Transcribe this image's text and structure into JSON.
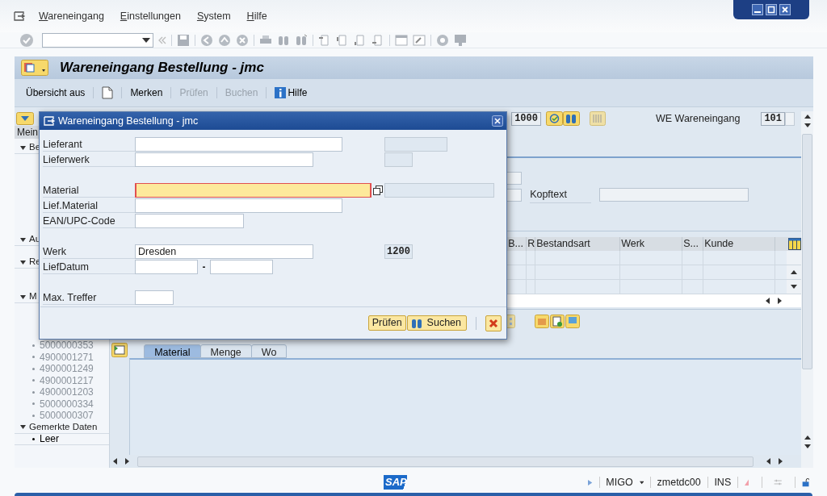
{
  "menu_bar": {
    "items": [
      "Wareneingang",
      "Einstellungen",
      "System",
      "Hilfe"
    ]
  },
  "title": "Wareneingang Bestellung - jmc",
  "app_toolbar": [
    {
      "kind": "text",
      "label": "Übersicht aus",
      "disabled": false
    },
    {
      "kind": "doc",
      "disabled": false
    },
    {
      "kind": "text",
      "label": "Merken",
      "disabled": false
    },
    {
      "kind": "text",
      "label": "Prüfen",
      "disabled": true
    },
    {
      "kind": "text",
      "label": "Buchen",
      "disabled": true
    },
    {
      "kind": "info",
      "label": "Hilfe",
      "disabled": false
    }
  ],
  "navigation": {
    "header": "Mein",
    "sections": [
      {
        "label": "Be",
        "expanded": true
      },
      {
        "label": "Au",
        "expanded": true
      },
      {
        "label": "Re",
        "expanded": true
      },
      {
        "label": "M",
        "expanded": true,
        "items": [
          {
            "label": "5000000353",
            "disabled": true
          },
          {
            "label": "4900001271",
            "disabled": true
          },
          {
            "label": "4900001249",
            "disabled": true
          },
          {
            "label": "4900001217",
            "disabled": true
          },
          {
            "label": "4900001203",
            "disabled": true
          },
          {
            "label": "5000000334",
            "disabled": true
          },
          {
            "label": "5000000307",
            "disabled": true
          }
        ]
      },
      {
        "label": "Gemerkte Daten",
        "expanded": true,
        "items": [
          {
            "label": "Leer",
            "disabled": false
          }
        ]
      }
    ]
  },
  "header": {
    "document_number": "1000",
    "movement_label": "WE Wareneingang",
    "movement_type": "101",
    "header_text_label": "Kopftext"
  },
  "items_table": {
    "columns": [
      "B...",
      "R",
      "Bestandsart",
      "Werk",
      "S...",
      "Kunde"
    ]
  },
  "detail_tabs": [
    {
      "label": "Material",
      "selected": true
    },
    {
      "label": "Menge",
      "selected": false
    },
    {
      "label": "Wo",
      "selected": false
    }
  ],
  "dialog": {
    "title": "Wareneingang Bestellung - jmc",
    "groups": [
      [
        {
          "label": "Lieferant",
          "kind": "input",
          "focused": false
        },
        {
          "label": "Lieferwerk",
          "kind": "input",
          "focused": false
        }
      ],
      [
        {
          "label": "Material",
          "kind": "input",
          "focused": true
        },
        {
          "label": "Lief.Material",
          "kind": "input",
          "focused": false
        },
        {
          "label": "EAN/UPC-Code",
          "kind": "input",
          "focused": false
        }
      ],
      [
        {
          "label": "Werk",
          "kind": "input",
          "focused": false,
          "value": "Dresden",
          "side_value": "1200"
        },
        {
          "label": "LiefDatum",
          "kind": "range",
          "separator": "-"
        }
      ],
      [
        {
          "label": "Max. Treffer",
          "kind": "input",
          "focused": false
        }
      ]
    ],
    "buttons": [
      "Prüfen",
      "Suchen"
    ]
  },
  "status_bar": {
    "logo": "SAP",
    "transaction": "MIGO",
    "server": "zmetdc00",
    "mode": "INS"
  }
}
